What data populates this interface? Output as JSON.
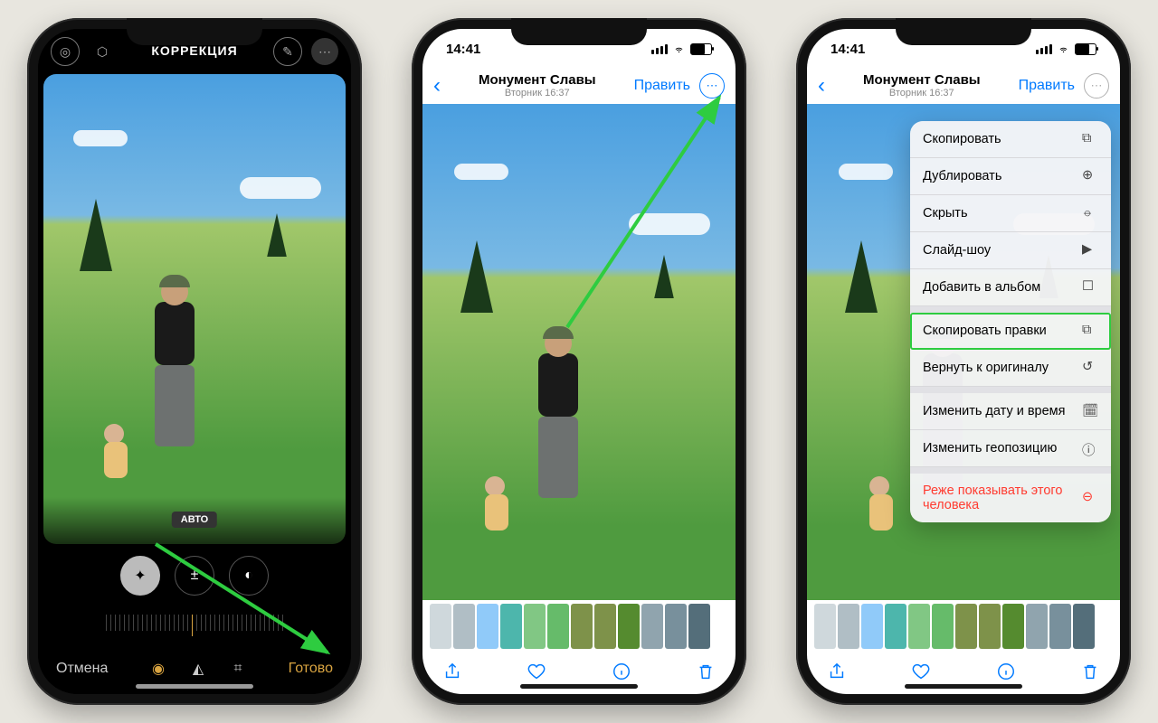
{
  "phone1": {
    "title": "КОРРЕКЦИЯ",
    "auto_pill": "АВТО",
    "cancel": "Отмена",
    "done": "Готово"
  },
  "phone2": {
    "time": "14:41",
    "title": "Монумент Славы",
    "subtitle": "Вторник  16:37",
    "edit": "Править"
  },
  "phone3": {
    "time": "14:41",
    "title": "Монумент Славы",
    "subtitle": "Вторник  16:37",
    "edit": "Править",
    "menu": {
      "copy": "Скопировать",
      "duplicate": "Дублировать",
      "hide": "Скрыть",
      "slideshow": "Слайд-шоу",
      "add_album": "Добавить в альбом",
      "copy_edits": "Скопировать правки",
      "revert": "Вернуть к оригиналу",
      "adjust_date": "Изменить дату и время",
      "adjust_location": "Изменить геопозицию",
      "feature_less": "Реже показывать этого человека"
    },
    "highlighted_item": "copy_edits"
  },
  "thumb_colors": [
    "#cfd8dc",
    "#b0bec5",
    "#90caf9",
    "#4db6ac",
    "#81c784",
    "#66bb6a",
    "#7e924a",
    "#7e924a",
    "#558b2f",
    "#90a4ae",
    "#78909c",
    "#546e7a"
  ]
}
